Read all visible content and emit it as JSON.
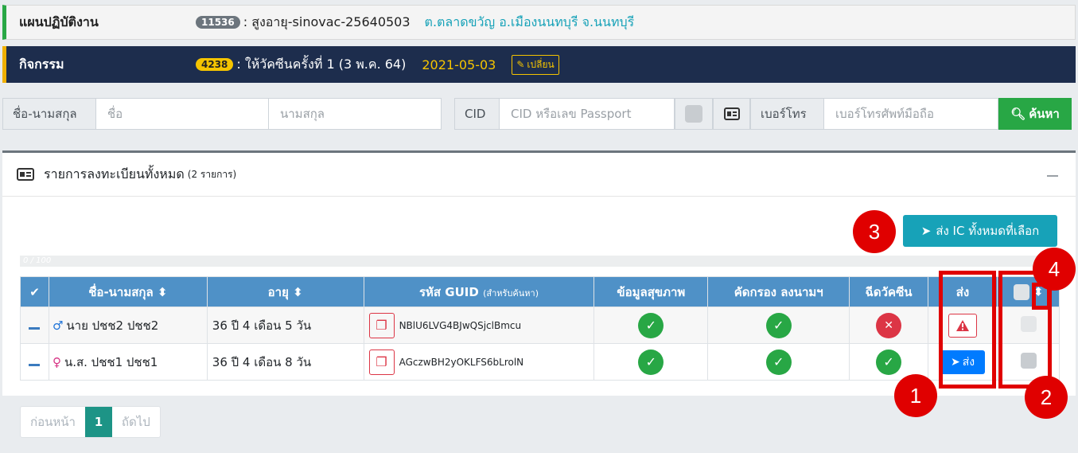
{
  "plan": {
    "title": "แผนปฏิบัติงาน",
    "id": "11536",
    "name": ": สูงอายุ-sinovac-25640503",
    "location": "ต.ตลาดขวัญ อ.เมืองนนทบุรี จ.นนทบุรี"
  },
  "activity": {
    "title": "กิจกรรม",
    "id": "4238",
    "name": ": ให้วัคซีนครั้งที่ 1 (3 พ.ค. 64)",
    "date": "2021-05-03",
    "change_label": "เปลี่ยน"
  },
  "search": {
    "name_label": "ชื่อ-นามสกุล",
    "first_placeholder": "ชื่อ",
    "last_placeholder": "นามสกุล",
    "cid_label": "CID",
    "cid_placeholder": "CID หรือเลข Passport",
    "phone_label": "เบอร์โทร",
    "phone_placeholder": "เบอร์โทรศัพท์มือถือ",
    "search_button": "ค้นหา"
  },
  "card": {
    "title": "รายการลงทะเบียนทั้งหมด",
    "count": "(2 รายการ)",
    "send_all": "ส่ง IC ทั้งหมดที่เลือก",
    "progress": "0 / 100"
  },
  "table": {
    "headers": {
      "name": "ชื่อ-นามสกุล",
      "age": "อายุ",
      "guid": "รหัส GUID",
      "guid_note": "(สำหรับค้นหา)",
      "health": "ข้อมูลสุขภาพ",
      "screen": "คัดกรอง ลงนามฯ",
      "vaccine": "ฉีดวัคซีน",
      "send": "ส่ง"
    },
    "rows": [
      {
        "name": "นาย ปชช2 ปชช2",
        "age": "36 ปี 4 เดือน 5 วัน",
        "guid": "NBlU6LVG4BJwQSjclBmcu",
        "health": "ok",
        "screen": "ok",
        "vaccine": "fail",
        "send": "warning"
      },
      {
        "name": "น.ส. ปชช1 ปชช1",
        "age": "36 ปี 4 เดือน 8 วัน",
        "guid": "AGczwBH2yOKLFS6bLrolN",
        "health": "ok",
        "screen": "ok",
        "vaccine": "ok",
        "send_label": "ส่ง"
      }
    ]
  },
  "pager": {
    "prev": "ก่อนหน้า",
    "page": "1",
    "next": "ถัดไป"
  },
  "annotations": [
    "1",
    "2",
    "3",
    "4"
  ],
  "colors": {
    "green": "#28a745",
    "red": "#dc3545",
    "header_blue": "#4f91c7",
    "teal": "#17a2b8",
    "navy": "#1d2d4d",
    "annotation": "#e00000"
  }
}
